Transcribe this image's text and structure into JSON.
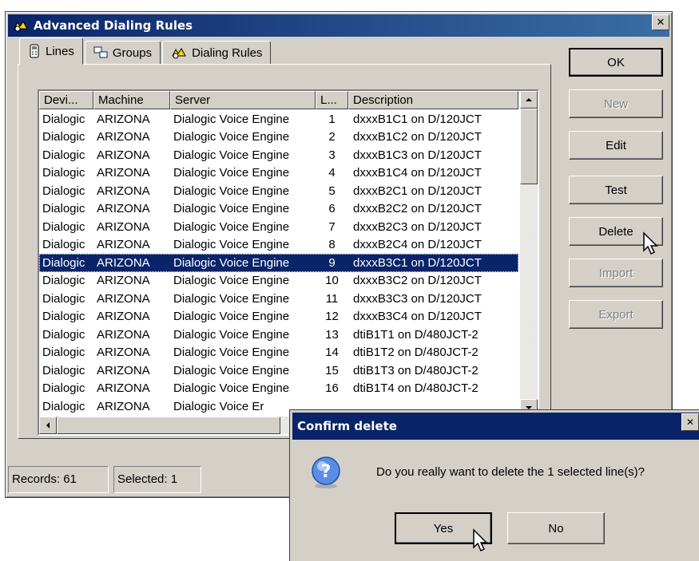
{
  "window": {
    "title": "Advanced Dialing Rules",
    "close_glyph": "✕"
  },
  "tabs": [
    {
      "label": "Lines",
      "icon": "phone-icon",
      "active": true
    },
    {
      "label": "Groups",
      "icon": "groups-icon",
      "active": false
    },
    {
      "label": "Dialing Rules",
      "icon": "dialing-rules-icon",
      "active": false
    }
  ],
  "list": {
    "columns": [
      "Devi...",
      "Machine",
      "Server",
      "L...",
      "Description"
    ],
    "rows": [
      [
        "Dialogic",
        "ARIZONA",
        "Dialogic Voice Engine",
        "1",
        "dxxxB1C1 on D/120JCT"
      ],
      [
        "Dialogic",
        "ARIZONA",
        "Dialogic Voice Engine",
        "2",
        "dxxxB1C2 on D/120JCT"
      ],
      [
        "Dialogic",
        "ARIZONA",
        "Dialogic Voice Engine",
        "3",
        "dxxxB1C3 on D/120JCT"
      ],
      [
        "Dialogic",
        "ARIZONA",
        "Dialogic Voice Engine",
        "4",
        "dxxxB1C4 on D/120JCT"
      ],
      [
        "Dialogic",
        "ARIZONA",
        "Dialogic Voice Engine",
        "5",
        "dxxxB2C1 on D/120JCT"
      ],
      [
        "Dialogic",
        "ARIZONA",
        "Dialogic Voice Engine",
        "6",
        "dxxxB2C2 on D/120JCT"
      ],
      [
        "Dialogic",
        "ARIZONA",
        "Dialogic Voice Engine",
        "7",
        "dxxxB2C3 on D/120JCT"
      ],
      [
        "Dialogic",
        "ARIZONA",
        "Dialogic Voice Engine",
        "8",
        "dxxxB2C4 on D/120JCT"
      ],
      [
        "Dialogic",
        "ARIZONA",
        "Dialogic Voice Engine",
        "9",
        "dxxxB3C1 on D/120JCT"
      ],
      [
        "Dialogic",
        "ARIZONA",
        "Dialogic Voice Engine",
        "10",
        "dxxxB3C2 on D/120JCT"
      ],
      [
        "Dialogic",
        "ARIZONA",
        "Dialogic Voice Engine",
        "11",
        "dxxxB3C3 on D/120JCT"
      ],
      [
        "Dialogic",
        "ARIZONA",
        "Dialogic Voice Engine",
        "12",
        "dxxxB3C4 on D/120JCT"
      ],
      [
        "Dialogic",
        "ARIZONA",
        "Dialogic Voice Engine",
        "13",
        "dtiB1T1 on D/480JCT-2"
      ],
      [
        "Dialogic",
        "ARIZONA",
        "Dialogic Voice Engine",
        "14",
        "dtiB1T2 on D/480JCT-2"
      ],
      [
        "Dialogic",
        "ARIZONA",
        "Dialogic Voice Engine",
        "15",
        "dtiB1T3 on D/480JCT-2"
      ],
      [
        "Dialogic",
        "ARIZONA",
        "Dialogic Voice Engine",
        "16",
        "dtiB1T4 on D/480JCT-2"
      ],
      [
        "Dialogic",
        "ARIZONA",
        "Dialogic Voice Er",
        "",
        ""
      ]
    ],
    "selected_row": 9
  },
  "buttons": {
    "ok": "OK",
    "new": "New",
    "edit": "Edit",
    "test": "Test",
    "delete": "Delete",
    "import": "Import",
    "export": "Export"
  },
  "status": {
    "records": "Records: 61",
    "selected": "Selected: 1"
  },
  "dialog": {
    "title": "Confirm delete",
    "close_glyph": "✕",
    "message": "Do you really want to delete the 1 selected line(s)?",
    "yes": "Yes",
    "no": "No",
    "icon": "question-icon"
  },
  "colors": {
    "face": "#d4d0c8",
    "title_bar": "#0a246a",
    "selection": "#0a246a"
  }
}
